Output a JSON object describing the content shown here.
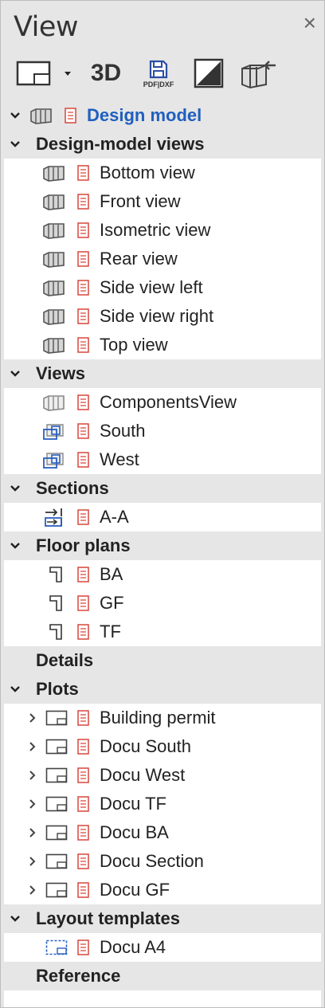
{
  "panel": {
    "title": "View",
    "close_label": "×"
  },
  "toolbar": {
    "threed_label": "3D",
    "pdf_label": "PDF|DXF"
  },
  "root": {
    "label": "Design model"
  },
  "groups": {
    "design_views": {
      "label": "Design-model views",
      "items": [
        "Bottom view",
        "Front view",
        "Isometric view",
        "Rear view",
        "Side view left",
        "Side view right",
        "Top view"
      ]
    },
    "views": {
      "label": "Views",
      "items": [
        "ComponentsView",
        "South",
        "West"
      ]
    },
    "sections": {
      "label": "Sections",
      "items": [
        "A-A"
      ]
    },
    "floor_plans": {
      "label": "Floor plans",
      "items": [
        "BA",
        "GF",
        "TF"
      ]
    },
    "details": {
      "label": "Details"
    },
    "plots": {
      "label": "Plots",
      "items": [
        "Building permit",
        "Docu South",
        "Docu West",
        "Docu TF",
        "Docu BA",
        "Docu Section",
        "Docu GF"
      ]
    },
    "layout_templates": {
      "label": "Layout templates",
      "items": [
        "Docu A4"
      ]
    },
    "reference": {
      "label": "Reference"
    }
  },
  "colors": {
    "accent": "#1f5fbf",
    "doc_red": "#d9463b",
    "panel_bg": "#e6e6e6"
  }
}
